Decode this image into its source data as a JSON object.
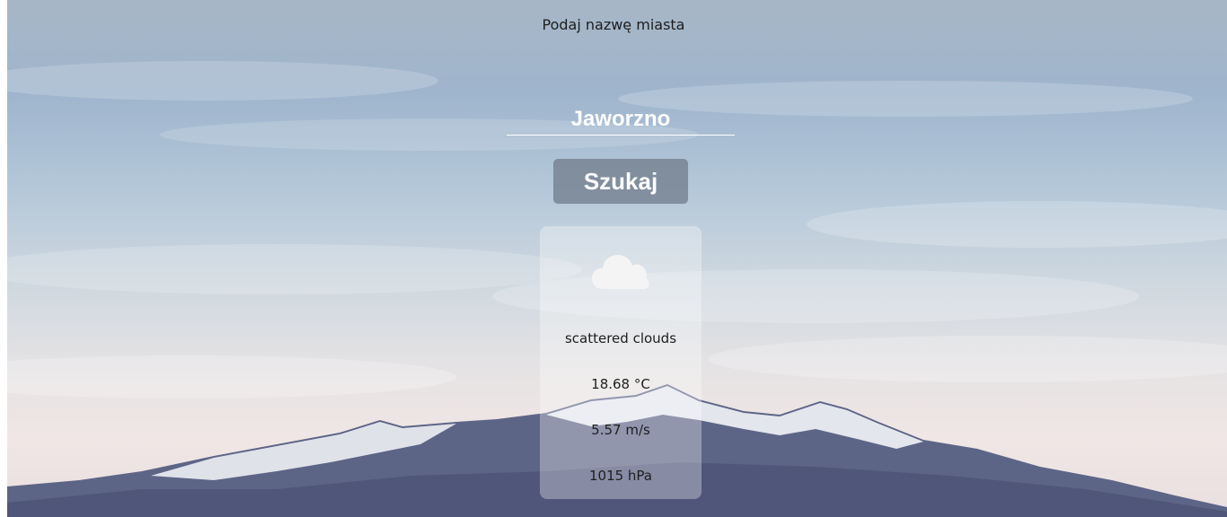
{
  "header": {
    "prompt": "Podaj nazwę miasta"
  },
  "search": {
    "city_value": "Jaworzno",
    "button_label": "Szukaj"
  },
  "weather": {
    "icon": "cloud-icon",
    "description": "scattered clouds",
    "temperature": "18.68 °C",
    "wind": "5.57 m/s",
    "pressure": "1015 hPa"
  }
}
